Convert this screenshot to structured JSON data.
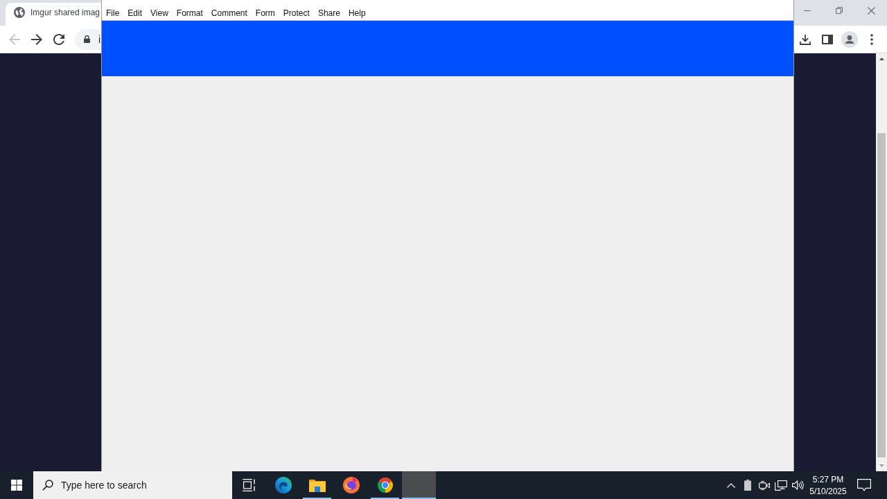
{
  "browser": {
    "tab": {
      "title": "Imgur shared imag"
    },
    "back_button": {
      "disabled": true
    },
    "forward_button": {
      "disabled": false
    },
    "address_bar": {
      "url": "i"
    }
  },
  "reader_window": {
    "menu": [
      "File",
      "Edit",
      "View",
      "Format",
      "Comment",
      "Form",
      "Protect",
      "Share",
      "Help"
    ]
  },
  "taskbar": {
    "search": {
      "placeholder": "Type here to search"
    },
    "apps": [
      {
        "kind": "edge",
        "running": false,
        "selected": false
      },
      {
        "kind": "explorer",
        "running": true,
        "selected": false
      },
      {
        "kind": "firefox",
        "running": false,
        "selected": false
      },
      {
        "kind": "chrome",
        "running": true,
        "selected": false
      },
      {
        "kind": "window",
        "running": true,
        "selected": true
      }
    ],
    "clock": {
      "time": "5:27 PM",
      "date": "5/10/2025"
    }
  }
}
